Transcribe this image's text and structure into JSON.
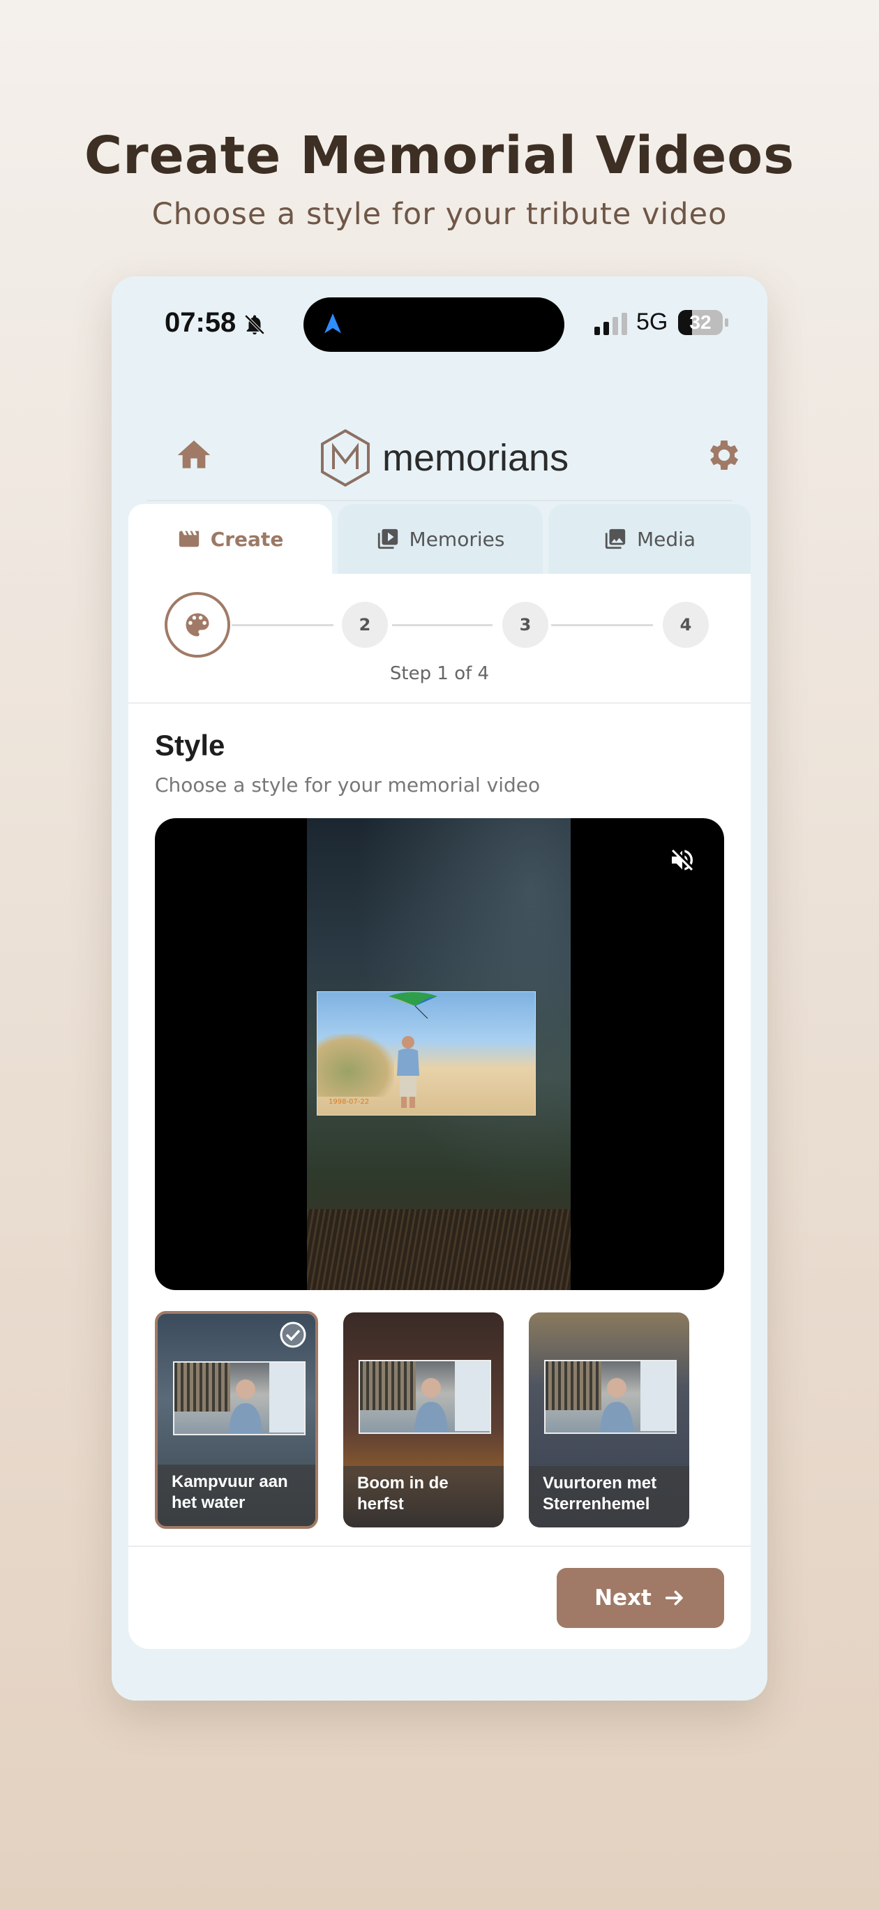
{
  "hero": {
    "title": "Create Memorial Videos",
    "subtitle": "Choose a style for your tribute video"
  },
  "status_bar": {
    "time": "07:58",
    "network": "5G",
    "battery": "32",
    "icons": [
      "bell-slash-icon",
      "navigation-arrow-icon",
      "signal-icon",
      "battery-icon"
    ]
  },
  "app": {
    "logo_text": "memorians",
    "home_icon": "home-icon",
    "settings_icon": "gear-icon"
  },
  "tabs": [
    {
      "label": "Create",
      "icon": "clapperboard-icon",
      "active": true
    },
    {
      "label": "Memories",
      "icon": "video-library-icon",
      "active": false
    },
    {
      "label": "Media",
      "icon": "photo-library-icon",
      "active": false
    }
  ],
  "stepper": {
    "steps": [
      "palette-icon",
      "2",
      "3",
      "4"
    ],
    "current": 1,
    "caption": "Step 1 of 4"
  },
  "section": {
    "title": "Style",
    "subtitle": "Choose a style for your memorial video"
  },
  "video": {
    "photo_date": "1998-07-22",
    "mute_icon": "volume-mute-icon"
  },
  "styles": [
    {
      "name": "Kampvuur aan het water",
      "selected": true
    },
    {
      "name": "Boom in de herfst",
      "selected": false
    },
    {
      "name": "Vuurtoren met Sterrenhemel",
      "selected": false
    }
  ],
  "footer": {
    "next_label": "Next"
  },
  "colors": {
    "accent": "#a07a66",
    "hero_title": "#3d2f24",
    "phone_bg": "#e8f2f6"
  }
}
